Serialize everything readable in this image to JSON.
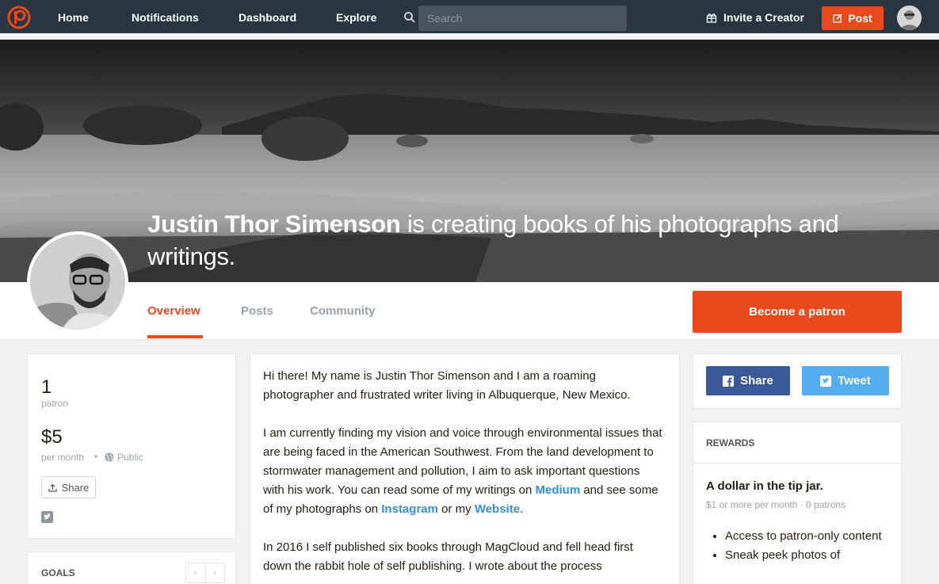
{
  "nav": {
    "links": [
      "Home",
      "Notifications",
      "Dashboard",
      "Explore"
    ],
    "search_placeholder": "Search",
    "invite_label": "Invite a Creator",
    "post_label": "Post"
  },
  "hero": {
    "creator_name": "Justin Thor Simenson",
    "tagline": " is creating books of his photographs and writings."
  },
  "tabs": [
    "Overview",
    "Posts",
    "Community"
  ],
  "become_patron_label": "Become a patron",
  "stats": {
    "patron_count": "1",
    "patron_label": "patron",
    "amount": "$5",
    "amount_label": "per month",
    "visibility": "Public",
    "share_label": "Share"
  },
  "goals": {
    "label": "GOALS"
  },
  "about": {
    "p1": "Hi there! My name is Justin Thor Simenson and I am a roaming photographer and frustrated writer living in Albuquerque, New Mexico.",
    "p2_a": "I am currently finding my vision and voice through environmental issues that are being faced in the American Southwest. From the land development to stormwater management and pollution, I aim to ask important questions with his work. You can read some of my writings on ",
    "link_medium": "Medium",
    "p2_b": " and see some of my photographs on ",
    "link_instagram": "Instagram",
    "p2_c": " or my ",
    "link_website": "Website",
    "p2_d": ".",
    "p3": "In 2016 I self published six books through MagCloud and fell head first down the rabbit hole of self publishing. I wrote about the process"
  },
  "share": {
    "facebook_label": "Share",
    "twitter_label": "Tweet"
  },
  "rewards": {
    "header": "REWARDS",
    "tier_title": "A dollar in the tip jar.",
    "tier_sub": "$1 or more per month · 0 patrons",
    "items": [
      "Access to patron-only content",
      "Sneak peek photos of"
    ]
  },
  "colors": {
    "brand": "#e8491d",
    "nav_bg": "#293541",
    "link": "#358edb",
    "facebook": "#3b5998",
    "twitter": "#55acee"
  }
}
